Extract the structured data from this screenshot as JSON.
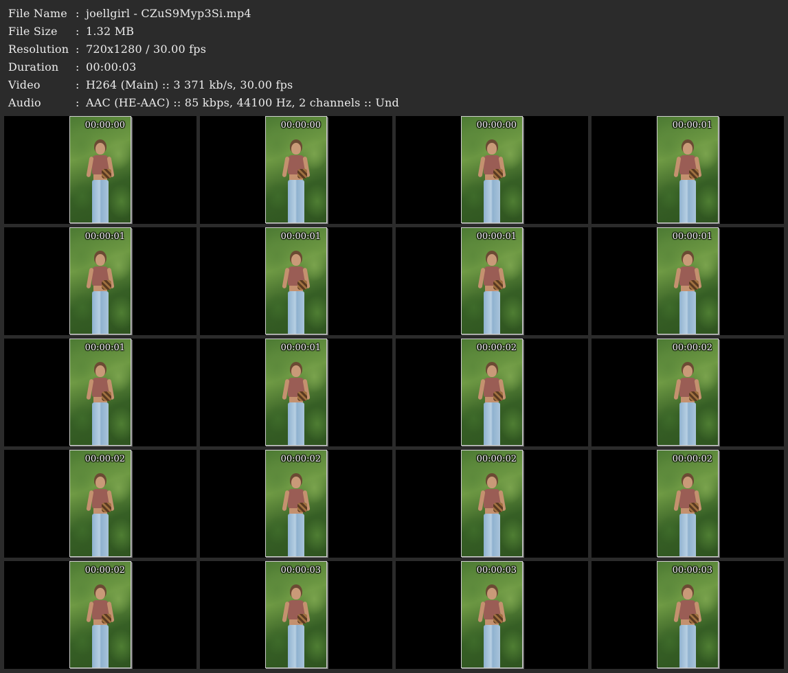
{
  "info": [
    {
      "key": "File Name",
      "sep": ":",
      "value": "joellgirl - CZuS9Myp3Si.mp4"
    },
    {
      "key": "File Size",
      "sep": ":",
      "value": "1.32 MB"
    },
    {
      "key": "Resolution",
      "sep": ":",
      "value": "720x1280 / 30.00 fps"
    },
    {
      "key": "Duration",
      "sep": ":",
      "value": "00:00:03"
    },
    {
      "key": "Video",
      "sep": ":",
      "value": "H264 (Main) :: 3 371 kb/s, 30.00 fps"
    },
    {
      "key": "Audio",
      "sep": ":",
      "value": "AAC (HE-AAC) :: 85 kbps, 44100 Hz, 2 channels :: Und"
    }
  ],
  "thumbnails": [
    {
      "timestamp": "00:00:00"
    },
    {
      "timestamp": "00:00:00"
    },
    {
      "timestamp": "00:00:00"
    },
    {
      "timestamp": "00:00:01"
    },
    {
      "timestamp": "00:00:01"
    },
    {
      "timestamp": "00:00:01"
    },
    {
      "timestamp": "00:00:01"
    },
    {
      "timestamp": "00:00:01"
    },
    {
      "timestamp": "00:00:01"
    },
    {
      "timestamp": "00:00:01"
    },
    {
      "timestamp": "00:00:02"
    },
    {
      "timestamp": "00:00:02"
    },
    {
      "timestamp": "00:00:02"
    },
    {
      "timestamp": "00:00:02"
    },
    {
      "timestamp": "00:00:02"
    },
    {
      "timestamp": "00:00:02"
    },
    {
      "timestamp": "00:00:02"
    },
    {
      "timestamp": "00:00:03"
    },
    {
      "timestamp": "00:00:03"
    },
    {
      "timestamp": "00:00:03"
    }
  ]
}
